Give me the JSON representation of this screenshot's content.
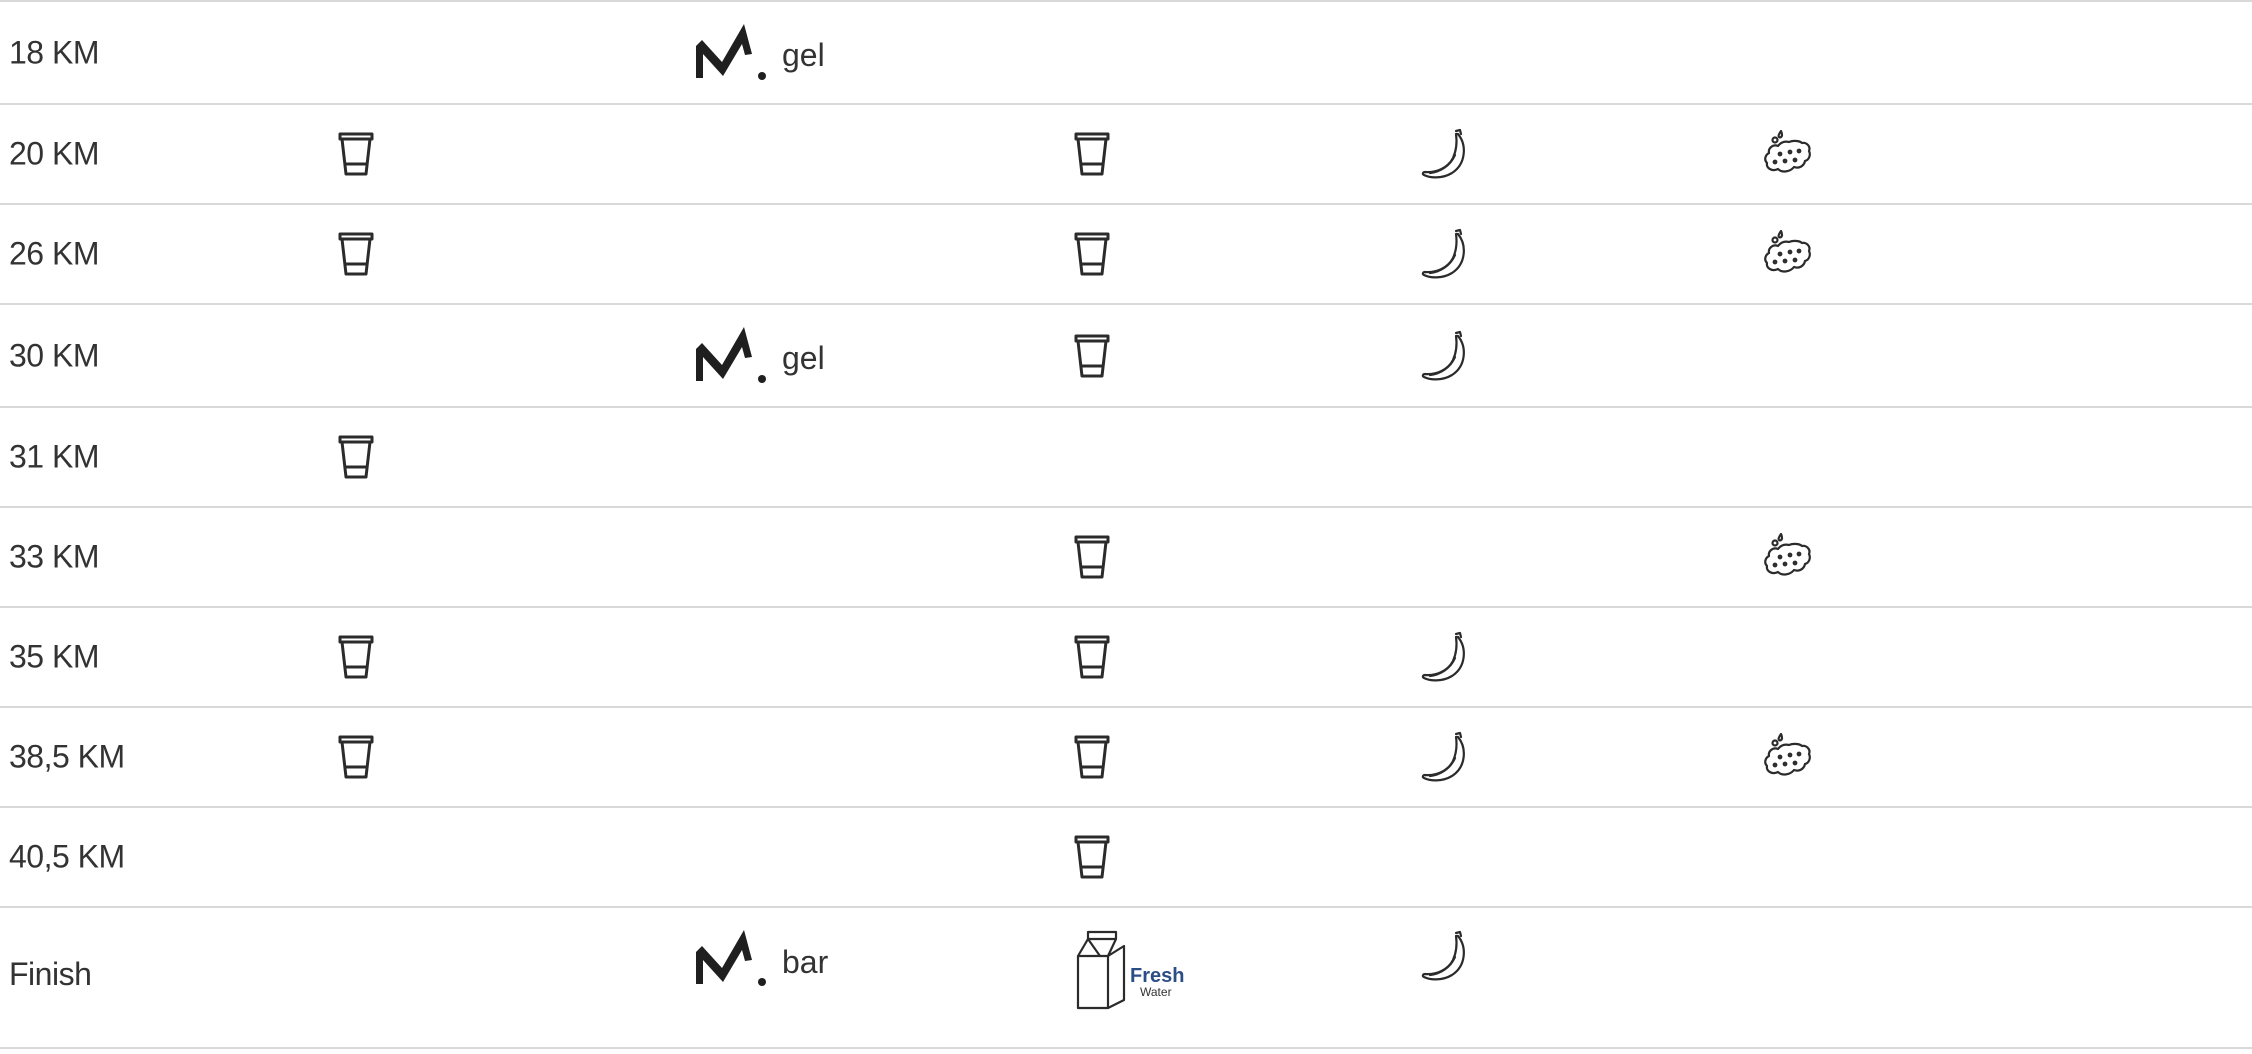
{
  "rows": [
    {
      "km": "18 KM",
      "water": false,
      "brand": "gel",
      "drink": false,
      "banana": false,
      "sponge": false
    },
    {
      "km": "20 KM",
      "water": true,
      "brand": "",
      "drink": true,
      "banana": true,
      "sponge": true
    },
    {
      "km": "26 KM",
      "water": true,
      "brand": "",
      "drink": true,
      "banana": true,
      "sponge": true
    },
    {
      "km": "30 KM",
      "water": false,
      "brand": "gel",
      "drink": true,
      "banana": true,
      "sponge": false
    },
    {
      "km": "31 KM",
      "water": true,
      "brand": "",
      "drink": false,
      "banana": false,
      "sponge": false
    },
    {
      "km": "33 KM",
      "water": false,
      "brand": "",
      "drink": true,
      "banana": false,
      "sponge": true
    },
    {
      "km": "35 KM",
      "water": true,
      "brand": "",
      "drink": true,
      "banana": true,
      "sponge": false
    },
    {
      "km": "38,5 KM",
      "water": true,
      "brand": "",
      "drink": true,
      "banana": true,
      "sponge": true
    },
    {
      "km": "40,5 KM",
      "water": false,
      "brand": "",
      "drink": true,
      "banana": false,
      "sponge": false
    },
    {
      "km": "Finish",
      "water": false,
      "brand": "bar",
      "drink": "fresh-water",
      "banana": true,
      "sponge": false
    }
  ],
  "fresh_water": {
    "word": "Fresh",
    "sub": "Water"
  },
  "icons": {
    "water": "cup-icon",
    "brand": "brand-m-logo",
    "drink": "cup-icon",
    "banana": "banana-icon",
    "sponge": "sponge-icon",
    "carton": "milk-carton-icon"
  },
  "colors": {
    "text": "#333333",
    "divider": "#d9d9d9",
    "fresh": "#2c4e86"
  }
}
